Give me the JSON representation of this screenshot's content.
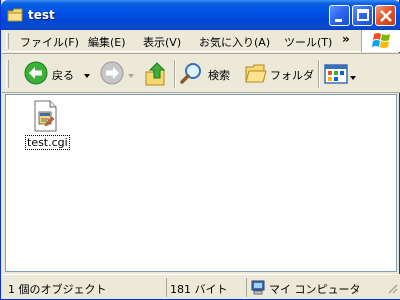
{
  "window": {
    "title": "test"
  },
  "menu": {
    "items": [
      "ファイル(F)",
      "編集(E)",
      "表示(V)",
      "お気に入り(A)",
      "ツール(T)"
    ],
    "more": "»"
  },
  "toolbar": {
    "back_label": "戻る",
    "search_label": "検索",
    "folders_label": "フォルダ"
  },
  "content": {
    "files": [
      {
        "name": "test.cgi",
        "icon": "cgi-file-icon"
      }
    ]
  },
  "status": {
    "objects": "1 個のオブジェクト",
    "size": "181 バイト",
    "location": "マイ コンピュータ"
  },
  "colors": {
    "title_bar": "#0052e6",
    "close_button": "#e2562a",
    "window_bg": "#ece9d8"
  }
}
